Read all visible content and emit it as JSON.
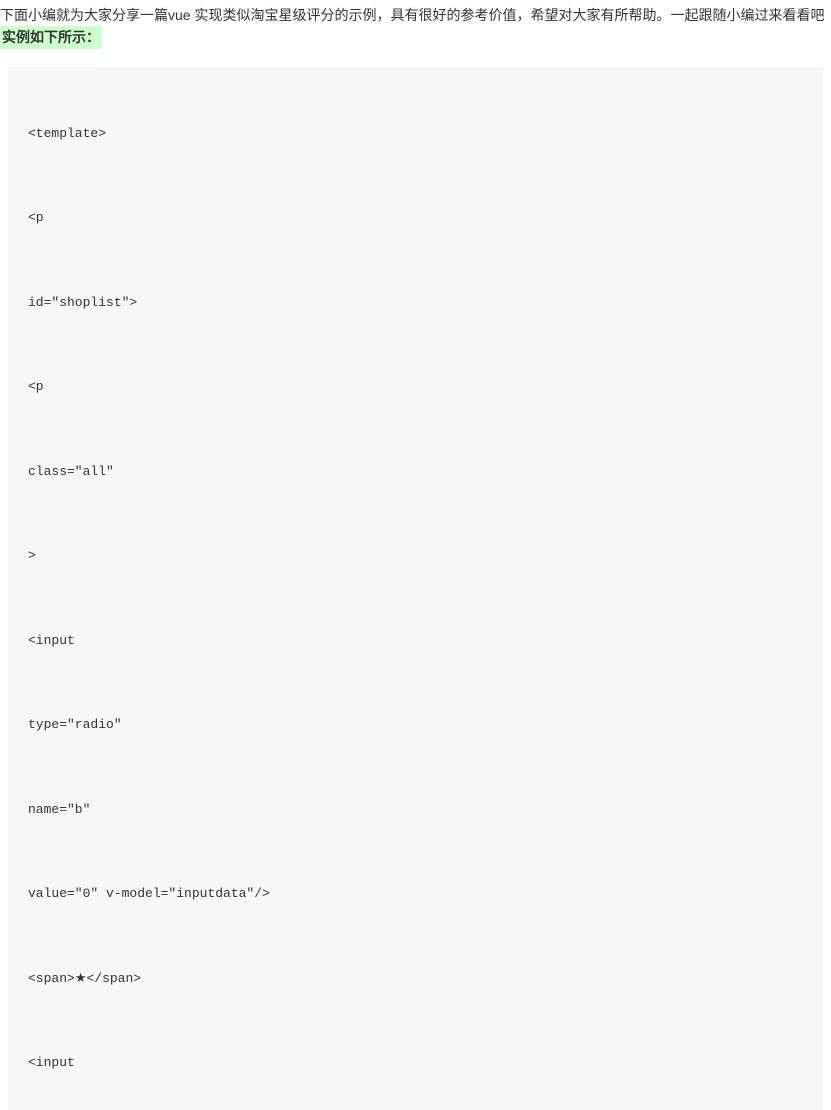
{
  "intro": {
    "paragraph": "下面小编就为大家分享一篇vue 实现类似淘宝星级评分的示例，具有很好的参考价值，希望对大家有所帮助。一起跟随小编过来看看吧",
    "highlight": "实例如下所示："
  },
  "code": {
    "lines": [
      "<template>",
      "<p",
      "id=\"shoplist\">",
      "<p",
      "class=\"all\"",
      ">",
      "<input",
      "type=\"radio\"",
      "name=\"b\"",
      "value=\"0\" v-model=\"inputdata\"/>",
      "<span>★</span>",
      "<input"
    ]
  }
}
